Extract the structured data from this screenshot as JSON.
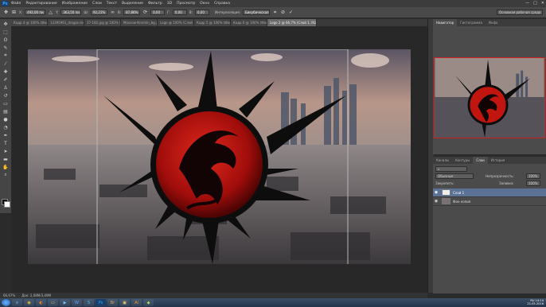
{
  "menu": {
    "logo": "Ps",
    "items": [
      "Файл",
      "Редактирование",
      "Изображение",
      "Слои",
      "Текст",
      "Выделение",
      "Фильтр",
      "3D",
      "Просмотр",
      "Окно",
      "Справка"
    ],
    "window_controls": [
      "—",
      "□",
      "✕"
    ]
  },
  "options_bar": {
    "x_label": "X:",
    "x_value": "492,00 пи",
    "y_label": "Y:",
    "y_value": "363,50 пи",
    "w_label": "Ш:",
    "w_value": "92,21%",
    "h_label": "В:",
    "h_value": "87,86%",
    "angle_value": "0,00",
    "h_skew_label": "Г:",
    "h_skew_value": "0,00",
    "v_skew_label": "В:",
    "v_skew_value": "0,00",
    "interp_label": "Интерполяция:",
    "interp_value": "Бикубическая",
    "workspace_select": "Основная рабочая среда"
  },
  "document_tabs": [
    {
      "label": "Кадр 4 @ 100% (Фон копия...",
      "active": false
    },
    {
      "label": "13395961_dragon-logo @ 6...",
      "active": false
    },
    {
      "label": "37-182.jpg @ 100% (Фон ко...",
      "active": false
    },
    {
      "label": "Moscow-Kremlin_bg.jpg @ ...",
      "active": false
    },
    {
      "label": "Logo @ 100% (Слой 1, RGB/...",
      "active": false
    },
    {
      "label": "Кадр 5 @ 100% (Фон ко...",
      "active": false
    },
    {
      "label": "Кадр 6 @ 100% (Фон...",
      "active": false
    },
    {
      "label": "Logo 2 @ 66,7% (Слой 1, RGB/8)",
      "active": true
    }
  ],
  "status_bar": {
    "zoom": "66,67%",
    "doc": "Док: 2,08М/3,49М"
  },
  "navigator": {
    "tabs": [
      "Навигатор",
      "Гистограмма",
      "Инфо"
    ]
  },
  "layers": {
    "tabs": [
      "Каналы",
      "Контуры",
      "Слои",
      "История"
    ],
    "blend_mode": "Обычные",
    "opacity_label": "Непрозрачность:",
    "opacity_value": "100%",
    "lock_label": "Закрепить:",
    "fill_label": "Заливка:",
    "fill_value": "100%",
    "items": [
      {
        "name": "Слой 1",
        "selected": true
      },
      {
        "name": "Фон копия",
        "selected": false
      }
    ]
  },
  "taskbar": {
    "apps": [
      "ie-icon",
      "chrome-icon",
      "firefox-icon",
      "explorer-icon",
      "media-icon",
      "word-icon",
      "skype-icon",
      "photoshop-icon",
      "bridge-icon",
      "folder-icon",
      "illustrator-icon",
      "app-icon"
    ],
    "lang": "RU",
    "time": "14:14",
    "date": "21.05.2016"
  }
}
